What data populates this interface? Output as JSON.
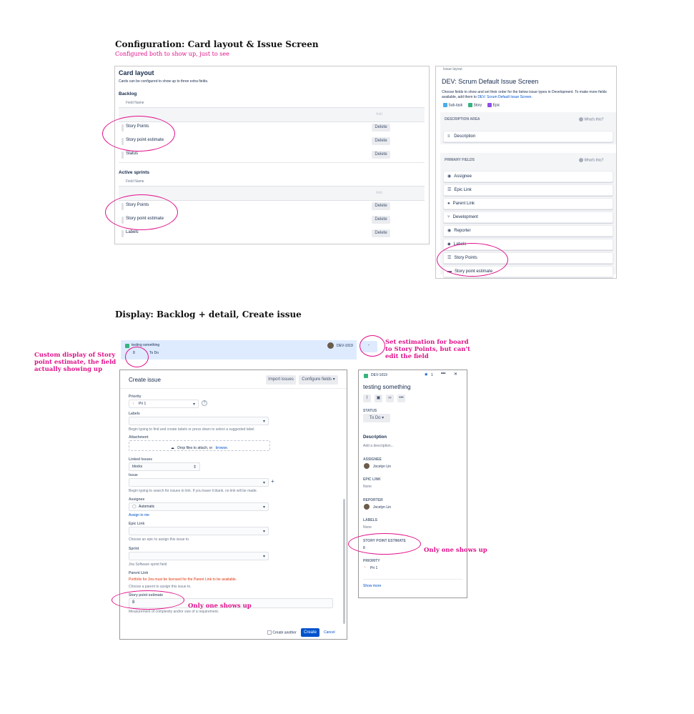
{
  "top": {
    "heading": "Configuration: Card layout & Issue Screen",
    "subnote": "Configured both to show up, just to see"
  },
  "card_layout": {
    "title": "Card layout",
    "desc": "Cards can be configured to show up to three extra fields.",
    "backlog": {
      "label": "Backlog",
      "col_header": "Field Name",
      "add_label": "Add",
      "rows": [
        {
          "name": "Story Points",
          "action": "Delete"
        },
        {
          "name": "Story point estimate",
          "action": "Delete"
        },
        {
          "name": "Status",
          "action": "Delete"
        }
      ]
    },
    "active": {
      "label": "Active sprints",
      "col_header": "Field Name",
      "add_label": "Add",
      "rows": [
        {
          "name": "Story Points",
          "action": "Delete"
        },
        {
          "name": "Story point estimate",
          "action": "Delete"
        },
        {
          "name": "Labels",
          "action": "Delete"
        }
      ]
    }
  },
  "issue_layout": {
    "crumb": "Issue layout",
    "title": "DEV: Scrum Default Issue Screen",
    "desc": "Choose fields to show and set their order for the below issue types in Development. To make more fields available, add them to",
    "desc_link": "DEV: Scrum Default Issue Screen.",
    "types": [
      "Sub-task",
      "Story",
      "Epic"
    ],
    "desc_area": "DESCRIPTION AREA",
    "whats_this": "What's this?",
    "desc_item": "Description",
    "primary": "PRIMARY FIELDS",
    "whats_this2": "What's this?",
    "fields": [
      "Assignee",
      "Epic Link",
      "Parent Link",
      "Development",
      "Reporter",
      "Labels",
      "Story Points",
      "Story point estimate"
    ]
  },
  "display": {
    "heading": "Display: Backlog + detail, Create issue"
  },
  "backlog_row": {
    "summary": "testing something",
    "estimate": "8",
    "status": "To Do",
    "key": "DEV-1019",
    "estimate_btn": "-"
  },
  "notes": {
    "left": "Custom display of Story point estimate, the field actually showing up",
    "right": "Set estimation for board to Story Points, but can't edit the field",
    "only_one_1": "Only one shows up",
    "only_one_2": "Only one shows up"
  },
  "create": {
    "title": "Create issue",
    "import": "Import issues",
    "configure": "Configure fields",
    "priority_label": "Priority",
    "priority_value": "Pri 1",
    "labels_label": "Labels",
    "labels_help": "Begin typing to find and create labels or press down to select a suggested label.",
    "attachment_label": "Attachment",
    "drop_text": "Drop files to attach, or",
    "browse": "browse.",
    "linked_label": "Linked Issues",
    "linked_value": "blocks",
    "issue_label": "Issue",
    "issue_help": "Begin typing to search for issues to link. If you leave it blank, no link will be made.",
    "assignee_label": "Assignee",
    "assignee_value": "Automatic",
    "assign_me": "Assign to me",
    "epic_label": "Epic Link",
    "epic_help": "Choose an epic to assign this issue to.",
    "sprint_label": "Sprint",
    "sprint_help": "Jira Software sprint field",
    "parent_label": "Parent Link",
    "parent_error": "Portfolio for Jira must be licensed for the Parent Link to be available.",
    "parent_help": "Choose a parent to assign this issue to.",
    "spe_label": "Story point estimate",
    "spe_value": "8",
    "spe_help": "Measurement of complexity and/or size of a requirement.",
    "create_another": "Create another",
    "create_btn": "Create",
    "cancel_btn": "Cancel"
  },
  "detail": {
    "key": "DEV-1019",
    "watch_count": "1",
    "title": "testing something",
    "status_label": "STATUS",
    "status_value": "To Do",
    "description_label": "Description",
    "description_placeholder": "Add a description...",
    "assignee_label": "ASSIGNEE",
    "assignee_value": "Jocelyn Lin",
    "epic_label": "EPIC LINK",
    "epic_value": "None",
    "reporter_label": "REPORTER",
    "reporter_value": "Jocelyn Lin",
    "labels_label": "LABELS",
    "labels_value": "None",
    "spe_label": "STORY POINT ESTIMATE",
    "spe_value": "8",
    "priority_label": "PRIORITY",
    "priority_value": "Pri 1",
    "show_more": "Show more"
  },
  "colors": {
    "annotation": "#e0118a",
    "primary": "#0052cc",
    "story": "#36b37e",
    "subtask": "#4bade8",
    "epic": "#904ee2",
    "backlog_row_bg": "#deebff",
    "error": "#de350b"
  }
}
